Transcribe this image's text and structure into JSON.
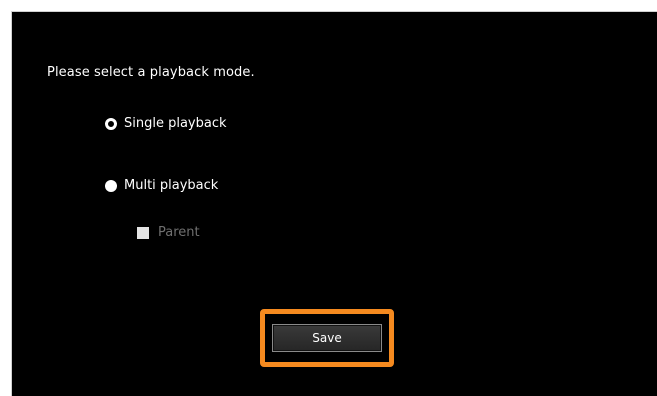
{
  "dialog": {
    "prompt": "Please select a playback mode.",
    "options": [
      {
        "label": "Single playback",
        "selected": false
      },
      {
        "label": "Multi playback",
        "selected": true
      }
    ],
    "parent_checkbox": {
      "label": "Parent",
      "enabled": false
    },
    "save_label": "Save"
  },
  "colors": {
    "panel_bg": "#000000",
    "text": "#ffffff",
    "disabled_text": "#6f6f6f",
    "highlight": "#f58a1f"
  }
}
